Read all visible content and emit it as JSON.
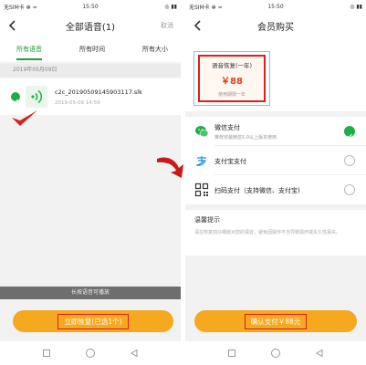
{
  "status_bar": {
    "carrier": "无SIM卡 ✻ ≈",
    "time": "15:50",
    "indicators": "◎ ▮▮"
  },
  "left": {
    "title": "全部语音(1)",
    "cancel_label": "取消",
    "tabs": [
      {
        "label": "所有语音",
        "active": true
      },
      {
        "label": "所有时间",
        "active": false
      },
      {
        "label": "所有大小",
        "active": false
      }
    ],
    "date_header": "2019年05月09日",
    "file": {
      "name": "c2c_20190509145903117.slk",
      "datetime": "2019-05-09 14:59",
      "selected": true,
      "icon": "voice-wave-icon"
    },
    "hint": "长按语音可播放",
    "restore_button": "立即恢复(已选1个)"
  },
  "right": {
    "title": "会员购买",
    "plan": {
      "name": "语音恢复(一年)",
      "price": "￥88",
      "term": "使用期限一年",
      "selected": true
    },
    "payment_methods": [
      {
        "name": "微信支付",
        "note": "推荐安装微信5.0以上版本使用",
        "icon": "wechat-pay-icon",
        "selected": true
      },
      {
        "name": "支付宝支付",
        "note": "",
        "icon": "alipay-icon",
        "selected": false
      },
      {
        "name": "扫码支付（支持微信、支付宝)",
        "note": "",
        "icon": "qr-code-icon",
        "selected": false
      }
    ],
    "tips_title": "温馨提示",
    "tips_body": "请在恢复前仔细核对您的语音，避免因操作不当导致损坏或永久性丢失。",
    "confirm_button": "确认支付￥88元"
  },
  "colors": {
    "accent_green": "#1eae46",
    "button_orange": "#f6a91e",
    "highlight_red": "#d82020",
    "price_red": "#e0401e"
  }
}
